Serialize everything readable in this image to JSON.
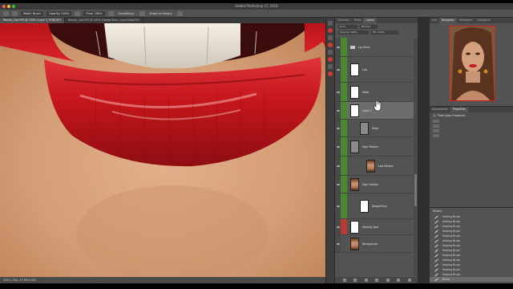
{
  "window": {
    "title": "Adobe Photoshop CC 2018"
  },
  "options_bar": {
    "items": [
      "Mode: Brush",
      "Opacity: 100%",
      "Flow: 100%",
      "Smoothing:",
      "Erase to History"
    ]
  },
  "doc_tabs": [
    {
      "label": "Beauty_Lips.PSD @ 100% (Layer 1, RGB/16*)",
      "active": true
    },
    {
      "label": "Beauty_Lips.PSD @ 100% (Dodge Burn, Layer Mask/16)",
      "active": false
    }
  ],
  "status_bar": {
    "text": "100% | Doc: 47.3M/1.08G"
  },
  "layers_panel": {
    "tabs": [
      {
        "label": "Channels",
        "active": false
      },
      {
        "label": "Paths",
        "active": false
      },
      {
        "label": "Layers",
        "active": true
      }
    ],
    "controls": {
      "kind": "Kind",
      "blend": "Normal",
      "opacity": "Opacity: 100%",
      "fill": "Fill: 100%"
    },
    "layers": [
      {
        "name": "Lip Shine",
        "kind": "folder",
        "tag": "green"
      },
      {
        "name": "Lips",
        "kind": "white",
        "tag": "green"
      },
      {
        "name": "Mask",
        "kind": "white",
        "tag": "green"
      },
      {
        "name": "Layer 1",
        "kind": "white",
        "tag": "green",
        "selected": true
      },
      {
        "name": "Mask",
        "kind": "gray",
        "tag": "green"
      },
      {
        "name": "High Median",
        "kind": "gray",
        "tag": "green"
      },
      {
        "name": "Low Median",
        "kind": "face",
        "tag": "green"
      },
      {
        "name": "High Median",
        "kind": "face",
        "tag": "green"
      },
      {
        "name": "Dodge Burn",
        "kind": "white",
        "tag": "green"
      },
      {
        "name": "Healing Spot",
        "kind": "white",
        "tag": "red"
      },
      {
        "name": "Background",
        "kind": "face",
        "tag": "none"
      }
    ]
  },
  "right_dock": {
    "nav_tabs": [
      "Info",
      "Navigator",
      "Histogram",
      "Histogram"
    ],
    "props_tabs": [
      "Adjustments",
      "Properties"
    ],
    "props_title": "Pixel Layer Properties",
    "history_title": "History",
    "history_items": [
      "Healing Brush",
      "Healing Brush",
      "Healing Brush",
      "Healing Brush",
      "Healing Brush",
      "Healing Brush",
      "Healing Brush",
      "Healing Brush",
      "Healing Brush",
      "Healing Brush",
      "Healing Brush",
      "Healing Brush",
      "Healing Brush",
      "Brush"
    ]
  },
  "colors": {
    "accent_green": "#4a8a2e",
    "accent_red": "#b83a32",
    "panel": "#535353",
    "selection": "#6c6c6c",
    "lip_red": "#c4161c"
  }
}
